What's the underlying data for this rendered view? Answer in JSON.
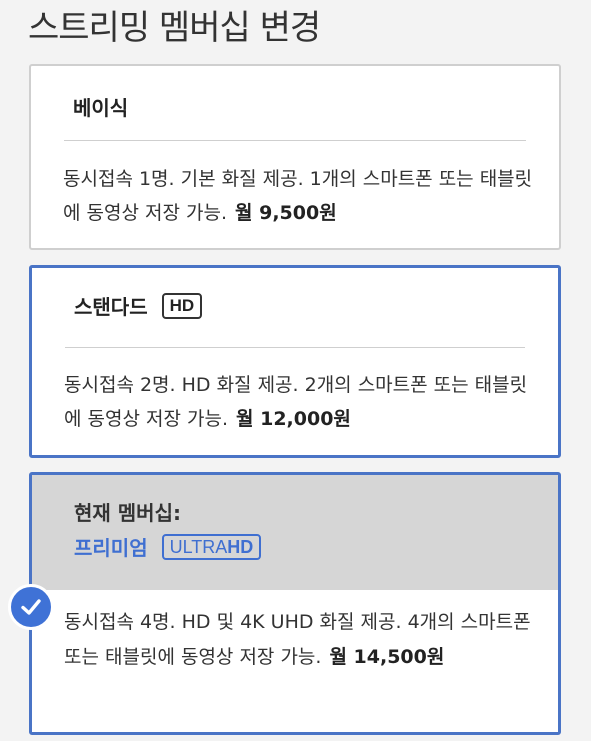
{
  "page": {
    "title": "스트리밍 멤버십 변경"
  },
  "plans": [
    {
      "name": "베이식",
      "badge": "",
      "description": "동시접속 1명. 기본 화질 제공. 1개의 스마트폰 또는 태블릿에 동영상 저장 가능.",
      "price": "월 9,500원",
      "selected": false
    },
    {
      "name": "스탠다드",
      "badge": "HD",
      "description": "동시접속 2명. HD 화질 제공. 2개의 스마트폰 또는 태블릿에 동영상 저장 가능.",
      "price": "월 12,000원",
      "selected": false
    },
    {
      "current_label": "현재 멤버십:",
      "name": "프리미엄",
      "badge_light": "ULTRA",
      "badge_bold": "HD",
      "description": "동시접속 4명. HD 및 4K UHD 화질 제공. 4개의 스마트폰 또는 태블릿에 동영상 저장 가능.",
      "price": "월 14,500원",
      "selected": true
    }
  ],
  "colors": {
    "accent": "#3f6fd1",
    "selected_border": "#4a74c6",
    "current_header_bg": "#d6d6d6",
    "check_bg": "#3f72d6"
  },
  "icons": {
    "selected": "checkmark-icon"
  }
}
